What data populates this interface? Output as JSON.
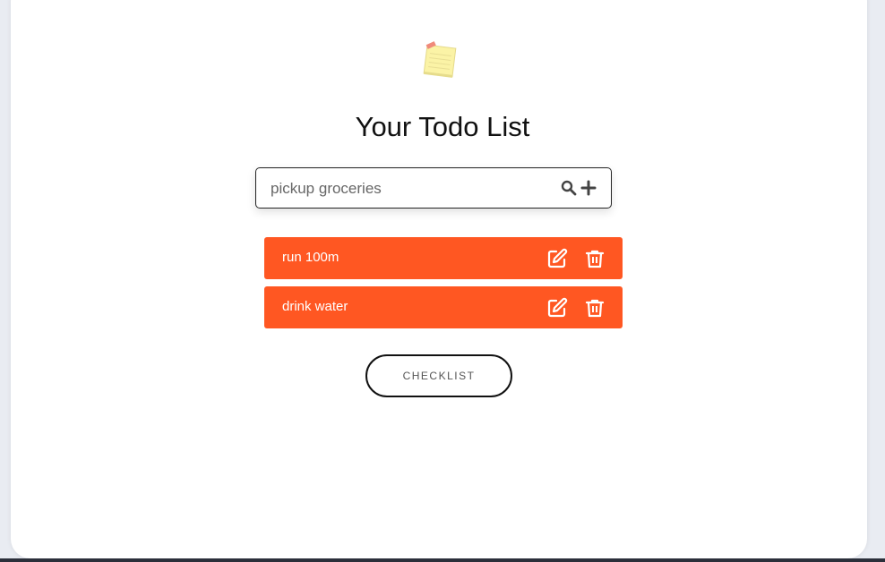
{
  "app": {
    "title": "Your Todo List",
    "logo_icon": "sticky-note-icon"
  },
  "search": {
    "placeholder": "pickup groceries",
    "value": "",
    "search_icon": "search-icon",
    "add_icon": "plus-icon"
  },
  "todos": [
    {
      "label": "run 100m",
      "edit_icon": "edit-icon",
      "delete_icon": "trash-icon"
    },
    {
      "label": "drink water",
      "edit_icon": "edit-icon",
      "delete_icon": "trash-icon"
    }
  ],
  "checklist_button": {
    "label": "CHECKLIST"
  },
  "colors": {
    "accent": "#ff5722",
    "background": "#ffffff",
    "page_background": "#e9ecf2"
  }
}
